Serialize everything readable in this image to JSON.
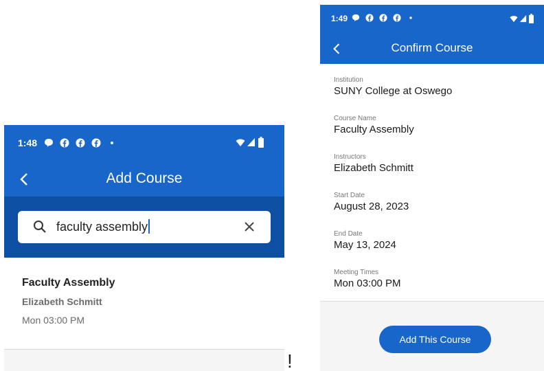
{
  "left_screen": {
    "status_bar": {
      "time": "1:48",
      "notification_icons": [
        "chat-bubble-icon",
        "facebook-icon",
        "facebook-icon",
        "facebook-icon",
        "dot-icon"
      ],
      "system_icons": [
        "wifi-icon",
        "signal-icon",
        "battery-icon"
      ]
    },
    "app_bar": {
      "title": "Add Course",
      "back_icon": "chevron-left-icon"
    },
    "search": {
      "value": "faculty assembly",
      "search_icon": "search-icon",
      "clear_icon": "close-icon"
    },
    "results": [
      {
        "title": "Faculty Assembly",
        "instructor": "Elizabeth Schmitt",
        "meeting": "Mon 03:00 PM"
      }
    ]
  },
  "stray_mark": "!",
  "right_screen": {
    "status_bar": {
      "time": "1:49",
      "notification_icons": [
        "chat-bubble-icon",
        "facebook-icon",
        "facebook-icon",
        "facebook-icon",
        "dot-icon"
      ],
      "system_icons": [
        "wifi-icon",
        "signal-icon",
        "battery-icon"
      ]
    },
    "app_bar": {
      "title": "Confirm Course",
      "back_icon": "chevron-left-icon"
    },
    "fields": [
      {
        "label": "Institution",
        "value": "SUNY College at Oswego"
      },
      {
        "label": "Course Name",
        "value": "Faculty Assembly"
      },
      {
        "label": "Instructors",
        "value": "Elizabeth Schmitt"
      },
      {
        "label": "Start Date",
        "value": "August 28, 2023"
      },
      {
        "label": "End Date",
        "value": "May 13, 2024"
      },
      {
        "label": "Meeting Times",
        "value": "Mon 03:00 PM"
      }
    ],
    "primary_button": "Add This Course"
  },
  "colors": {
    "primary": "#1866c9",
    "primary_dark": "#0d4fa3",
    "footer_bg": "#f5f5f5",
    "muted_text": "#6b6b6b"
  }
}
